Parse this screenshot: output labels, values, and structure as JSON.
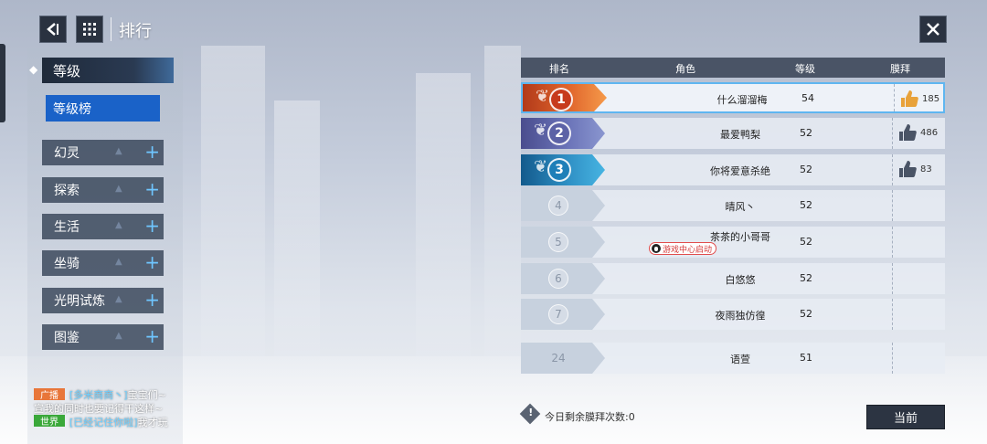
{
  "header": {
    "title": "排行",
    "back_icon": "back-arrow-icon",
    "menu_icon": "grid-menu-icon",
    "close_icon": "close-icon"
  },
  "sidebar": {
    "active_category": "等级",
    "active_sub": "等级榜",
    "categories": [
      {
        "label": "幻灵"
      },
      {
        "label": "探索"
      },
      {
        "label": "生活"
      },
      {
        "label": "坐骑"
      },
      {
        "label": "光明试炼"
      },
      {
        "label": "图鉴"
      }
    ]
  },
  "chat": [
    {
      "tag": "广播",
      "tag_color": "#e8763a",
      "user": "[多米商商丶]",
      "text": "宝宝们~",
      "line2": "宣我的同时也要记得干这样~"
    },
    {
      "tag": "世界",
      "tag_color": "#3aa83a",
      "user": "[已经记住你啦]",
      "text": "我才玩"
    }
  ],
  "table": {
    "headers": {
      "rank": "排名",
      "role": "角色",
      "level": "等级",
      "worship": "膜拜"
    },
    "rows": [
      {
        "rank": "1",
        "name": "什么溜溜梅",
        "level": "54",
        "likes": "185"
      },
      {
        "rank": "2",
        "name": "最爱鸭梨",
        "level": "52",
        "likes": "486"
      },
      {
        "rank": "3",
        "name": "你将爱意杀绝",
        "level": "52",
        "likes": "83"
      },
      {
        "rank": "4",
        "name": "晴风丶",
        "level": "52",
        "likes": ""
      },
      {
        "rank": "5",
        "name": "茶茶的小哥哥",
        "level": "52",
        "likes": "",
        "badge": "游戏中心启动"
      },
      {
        "rank": "6",
        "name": "白悠悠",
        "level": "52",
        "likes": ""
      },
      {
        "rank": "7",
        "name": "夜雨独仿徨",
        "level": "52",
        "likes": ""
      }
    ],
    "self_row": {
      "rank": "24",
      "name": "语萱",
      "level": "51",
      "likes": ""
    }
  },
  "footer": {
    "remain_text": "今日剩余膜拜次数:0",
    "current_button": "当前"
  },
  "colors": {
    "accent_blue": "#1a62c8",
    "rank1": "#c73a1c",
    "rank2": "#5c62a6",
    "rank3": "#1e7fb8"
  }
}
